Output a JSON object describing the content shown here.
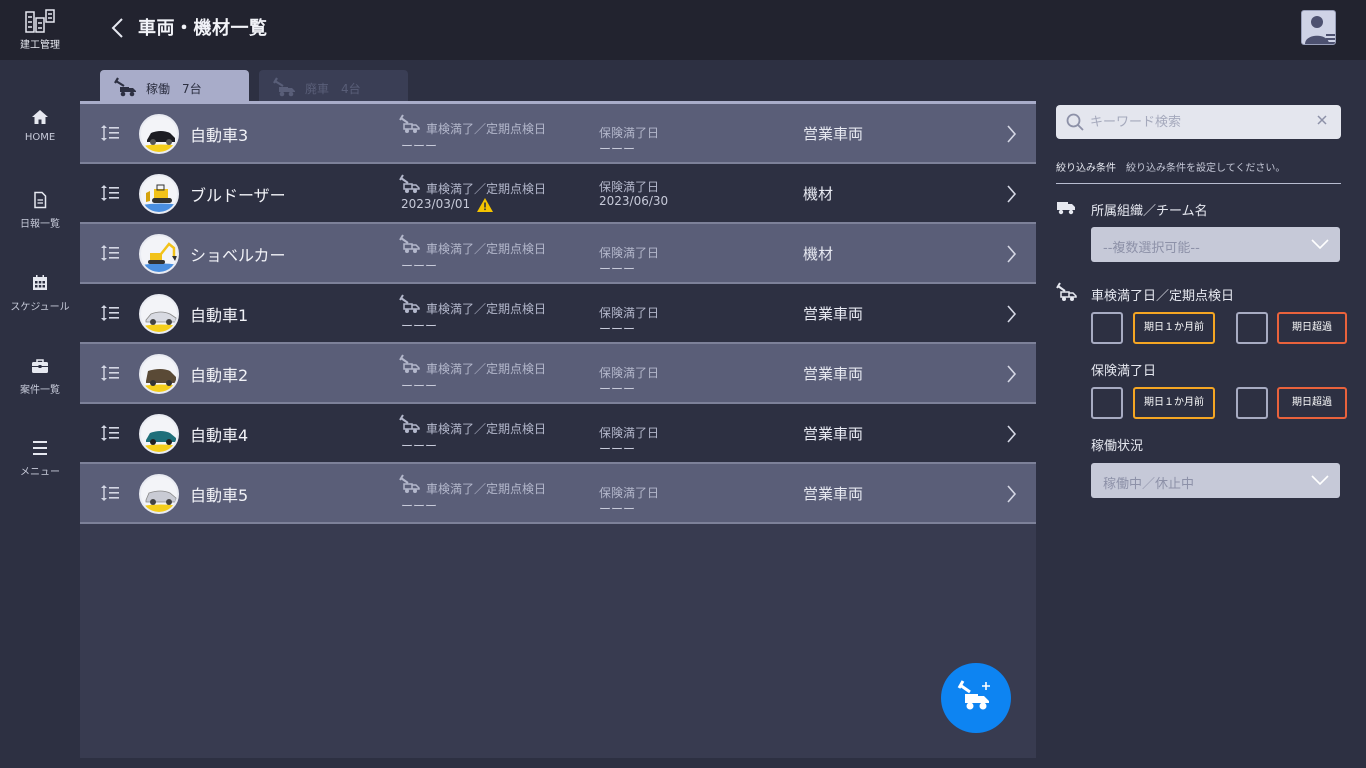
{
  "app": {
    "logo_text": "建工管理",
    "title": "車両・機材一覧"
  },
  "sidebar": {
    "items": [
      {
        "label": "HOME",
        "icon": "home-icon"
      },
      {
        "label": "日報一覧",
        "icon": "document-icon"
      },
      {
        "label": "スケジュール",
        "icon": "calendar-icon"
      },
      {
        "label": "案件一覧",
        "icon": "briefcase-icon"
      },
      {
        "label": "メニュー",
        "icon": "menu-icon"
      }
    ]
  },
  "tabs": [
    {
      "label": "稼働　7台",
      "active": true
    },
    {
      "label": "廃車　4台",
      "active": false
    }
  ],
  "list": {
    "inspection_label": "車検満了／定期点検日",
    "insurance_label": "保険満了日",
    "rows": [
      {
        "name": "自動車3",
        "inspection": "ーーー",
        "insurance": "ーーー",
        "type": "営業車両"
      },
      {
        "name": "ブルドーザー",
        "inspection": "2023/03/01",
        "insurance": "2023/06/30",
        "type": "機材",
        "warning": true
      },
      {
        "name": "ショベルカー",
        "inspection": "ーーー",
        "insurance": "ーーー",
        "type": "機材"
      },
      {
        "name": "自動車1",
        "inspection": "ーーー",
        "insurance": "ーーー",
        "type": "営業車両"
      },
      {
        "name": "自動車2",
        "inspection": "ーーー",
        "insurance": "ーーー",
        "type": "営業車両"
      },
      {
        "name": "自動車4",
        "inspection": "ーーー",
        "insurance": "ーーー",
        "type": "営業車両"
      },
      {
        "name": "自動車5",
        "inspection": "ーーー",
        "insurance": "ーーー",
        "type": "営業車両"
      }
    ]
  },
  "filter": {
    "search_placeholder": "キーワード検索",
    "title": "絞り込み条件",
    "description": "絞り込み条件を設定してください。",
    "org_label": "所属組織／チーム名",
    "org_placeholder": "--複数選択可能--",
    "inspection_label": "車検満了日／定期点検日",
    "insurance_label": "保険満了日",
    "option_month": "期日１か月前",
    "option_overdue": "期日超過",
    "status_label": "稼働状況",
    "status_placeholder": "稼働中／休止中"
  },
  "colors": {
    "accent": "#0d84f2",
    "warning": "#f5c400",
    "option_orange": "#f5a623",
    "option_red": "#e9623c"
  }
}
